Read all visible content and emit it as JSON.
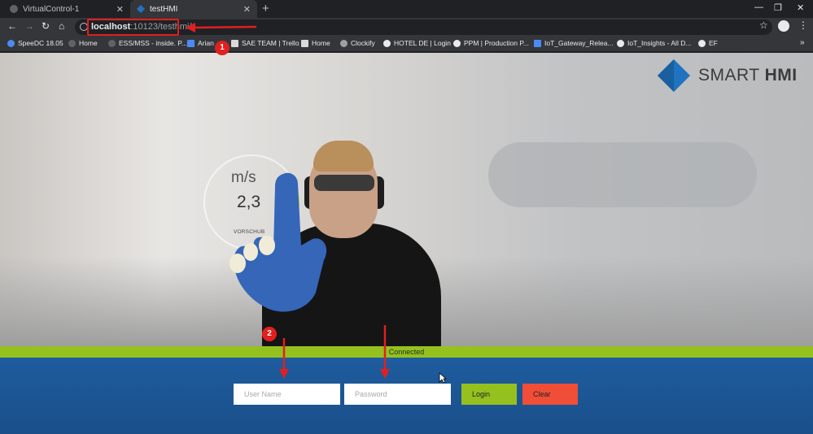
{
  "tabs": [
    {
      "label": "VirtualControl-1",
      "active": false
    },
    {
      "label": "testHMI",
      "active": true
    }
  ],
  "address": {
    "host": "localhost",
    "path": ":10123/testhmi/"
  },
  "bookmarks": [
    {
      "label": "SpeeDC 18.05"
    },
    {
      "label": "Home"
    },
    {
      "label": "ESS/MSS - inside. P..."
    },
    {
      "label": "Arian"
    },
    {
      "label": "SAE TEAM | Trello"
    },
    {
      "label": "Home"
    },
    {
      "label": "Clockify"
    },
    {
      "label": "HOTEL DE | Login"
    },
    {
      "label": "PPM | Production P..."
    },
    {
      "label": "IoT_Gateway_Relea..."
    },
    {
      "label": "IoT_Insights - All D..."
    },
    {
      "label": "EF"
    }
  ],
  "hero": {
    "gauge": {
      "unit": "m/s",
      "value": "2,3",
      "label": "VORSCHUB"
    },
    "logo": {
      "light": "SMART ",
      "bold": "HMI"
    }
  },
  "status": {
    "text": "Connected"
  },
  "login": {
    "username_placeholder": "User Name",
    "password_placeholder": "Password",
    "login_label": "Login",
    "clear_label": "Clear"
  },
  "annotations": {
    "badge1": "1",
    "badge2": "2"
  },
  "colors": {
    "accent_green": "#95c11f",
    "clear_red": "#f04e37",
    "panel_blue": "#1e5c9e",
    "annotation_red": "#e21f1f"
  }
}
